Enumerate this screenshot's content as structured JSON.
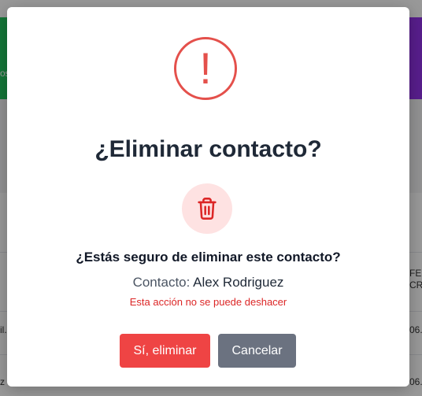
{
  "background": {
    "left_fragments": [
      "os",
      "il.",
      "z"
    ],
    "right_fragments": [
      "FEC",
      "CR",
      "06.",
      "06."
    ]
  },
  "dialog": {
    "warning_glyph": "!",
    "title": "¿Eliminar contacto?",
    "icon": "trash-icon",
    "question": "¿Estás seguro de eliminar este contacto?",
    "contact_label": "Contacto:",
    "contact_name": "Alex Rodriguez",
    "irreversible_note": "Esta acción no se puede deshacer",
    "confirm_label": "Sí, eliminar",
    "cancel_label": "Cancelar"
  },
  "colors": {
    "danger": "#ef4444",
    "warning_ring": "#e4504b",
    "neutral_button": "#6b7280",
    "trash_bg": "#fee2e2"
  }
}
